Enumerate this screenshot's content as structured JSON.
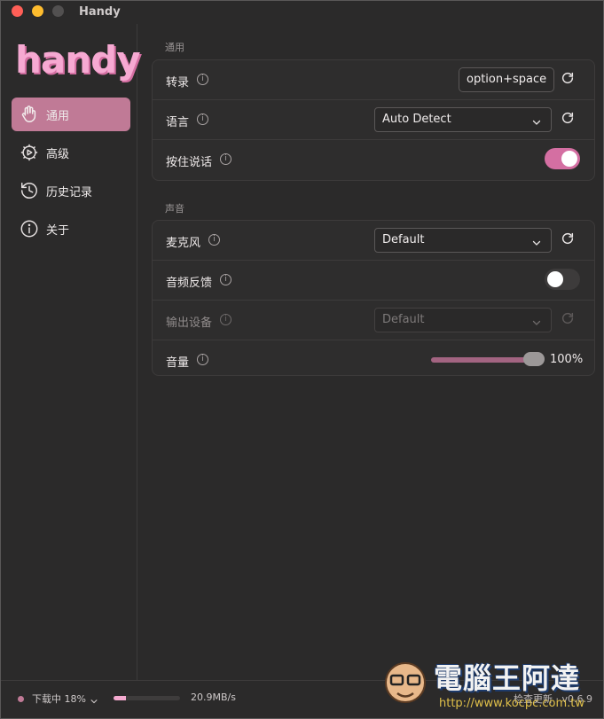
{
  "window": {
    "title": "Handy"
  },
  "sidebar": {
    "logo": "handy",
    "items": [
      {
        "label": "通用",
        "icon": "hand-icon",
        "active": true
      },
      {
        "label": "高级",
        "icon": "gear-play-icon",
        "active": false
      },
      {
        "label": "历史记录",
        "icon": "history-icon",
        "active": false
      },
      {
        "label": "关于",
        "icon": "info-icon",
        "active": false
      }
    ]
  },
  "general": {
    "section_label": "通用",
    "transcribe": {
      "label": "转录",
      "shortcut": "option+space"
    },
    "language": {
      "label": "语言",
      "value": "Auto Detect"
    },
    "push_to_talk": {
      "label": "按住说话",
      "enabled": true
    }
  },
  "sound": {
    "section_label": "声音",
    "microphone": {
      "label": "麦克风",
      "value": "Default"
    },
    "audio_feedback": {
      "label": "音频反馈",
      "enabled": false
    },
    "output_device": {
      "label": "输出设备",
      "value": "Default",
      "disabled": true
    },
    "volume": {
      "label": "音量",
      "value_text": "100%",
      "level": 1.0
    }
  },
  "footer": {
    "download_status": "下载中 18%",
    "progress": 0.18,
    "speed": "20.9MB/s",
    "update_text": "检查更新 · v0.6.9"
  },
  "watermark": {
    "text": "電腦王阿達",
    "url": "http://www.kocpc.com.tw"
  },
  "colors": {
    "accent": "#d46fa2",
    "active_nav": "#c07a96",
    "background": "#2b2a2a"
  }
}
